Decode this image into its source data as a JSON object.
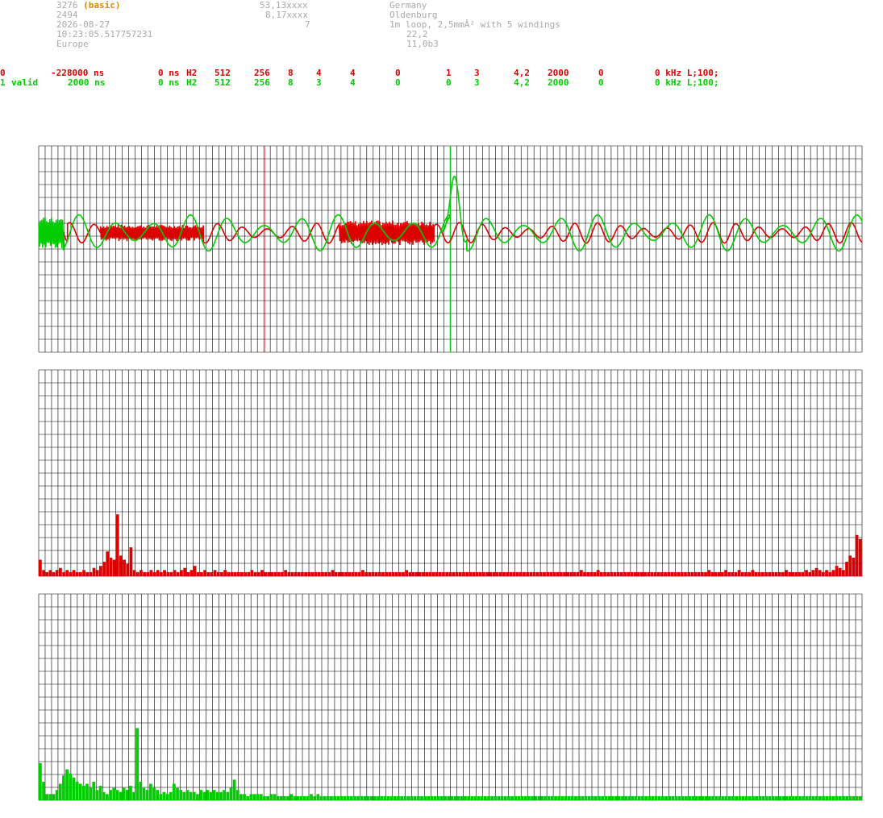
{
  "header": {
    "station_id": "3276",
    "station_type": "(basic)",
    "station_num": "2494",
    "date": "2026-08-27",
    "time": "10:23:05.517757231",
    "region": "Europe",
    "lat": "53,13xxxx",
    "lon": "8,17xxxx",
    "alt": "7",
    "country": "Germany",
    "city": "Oldenburg",
    "antenna": "1m loop, 2,5mmÂ² with 5 windings",
    "temp": "22,2",
    "version": "11,0b3"
  },
  "channels": [
    {
      "idx": "0",
      "status": "",
      "offset": "-228000 ns",
      "delay": "0 ns",
      "filter": "H2",
      "c1": "512",
      "c2": "256",
      "c3": "8",
      "c4": "4",
      "c5": "4",
      "c6": "0",
      "c7": "1",
      "c8": "3",
      "c9": "4,2",
      "c10": "2000",
      "c11": "0",
      "freq": "0 kHz L;100;"
    },
    {
      "idx": "1",
      "status": "valid",
      "offset": "2000 ns",
      "delay": "0 ns",
      "filter": "H2",
      "c1": "512",
      "c2": "256",
      "c3": "8",
      "c4": "3",
      "c5": "4",
      "c6": "0",
      "c7": "0",
      "c8": "3",
      "c9": "4,2",
      "c10": "2000",
      "c11": "0",
      "freq": "0 kHz L;100;"
    }
  ],
  "colors": {
    "channel0": "#dd0000",
    "channel1": "#00cc00",
    "grid": "#000000",
    "gray_text": "#a8a8a8",
    "type_label": "#d98a00"
  },
  "chart_data": [
    {
      "type": "line",
      "title": "",
      "ylim": [
        -1,
        1
      ],
      "grid": true,
      "trigger_marker_red_x": 0.275,
      "trigger_marker_green_x": 0.5,
      "series": [
        {
          "channel": 0,
          "color": "#dd0000",
          "segments": [
            {
              "x": [
                0.0,
                0.035
              ],
              "style": "wave",
              "amp": 0.08,
              "period": 0.02
            },
            {
              "x": [
                0.035,
                0.075
              ],
              "style": "wave",
              "amp": 0.1,
              "period": 0.03
            },
            {
              "x": [
                0.075,
                0.2
              ],
              "style": "dense",
              "amp": 0.08
            },
            {
              "x": [
                0.2,
                0.365
              ],
              "style": "wave",
              "amp": 0.1,
              "period": 0.03
            },
            {
              "x": [
                0.365,
                0.48
              ],
              "style": "dense",
              "amp": 0.12
            },
            {
              "x": [
                0.48,
                1.0
              ],
              "style": "wave",
              "amp": 0.1,
              "period": 0.028
            }
          ]
        },
        {
          "channel": 1,
          "color": "#00cc00",
          "segments": [
            {
              "x": [
                0.0,
                0.03
              ],
              "style": "dense",
              "amp": 0.15
            },
            {
              "x": [
                0.03,
                0.5
              ],
              "style": "wave",
              "amp": 0.18,
              "period": 0.045
            },
            {
              "x": [
                0.49,
                0.52
              ],
              "style": "spike",
              "peak": 0.55
            },
            {
              "x": [
                0.52,
                1.0
              ],
              "style": "wave",
              "amp": 0.18,
              "period": 0.045
            }
          ]
        }
      ]
    },
    {
      "type": "bar",
      "title": "",
      "channel": 0,
      "color": "#dd0000",
      "ylim": [
        0,
        100
      ],
      "values": [
        8,
        3,
        2,
        3,
        2,
        3,
        4,
        2,
        3,
        2,
        3,
        2,
        2,
        3,
        2,
        2,
        4,
        3,
        5,
        7,
        12,
        9,
        8,
        30,
        10,
        8,
        6,
        14,
        3,
        2,
        3,
        2,
        2,
        3,
        2,
        3,
        2,
        3,
        2,
        2,
        3,
        2,
        3,
        4,
        2,
        3,
        5,
        2,
        2,
        3,
        2,
        2,
        3,
        2,
        2,
        3,
        2,
        2,
        2,
        2,
        2,
        2,
        2,
        3,
        2,
        2,
        3,
        2,
        2,
        2,
        2,
        2,
        2,
        3,
        2,
        2,
        2,
        2,
        2,
        2,
        2,
        2,
        2,
        2,
        2,
        2,
        2,
        3,
        2,
        2,
        2,
        2,
        2,
        2,
        2,
        2,
        3,
        2,
        2,
        2,
        2,
        2,
        2,
        2,
        2,
        2,
        2,
        2,
        2,
        3,
        2,
        2,
        2,
        2,
        2,
        2,
        2,
        2,
        2,
        2,
        2,
        2,
        2,
        2,
        2,
        2,
        2,
        2,
        2,
        2,
        2,
        2,
        2,
        2,
        2,
        2,
        2,
        2,
        2,
        2,
        2,
        2,
        2,
        2,
        2,
        2,
        2,
        2,
        2,
        2,
        2,
        2,
        2,
        2,
        2,
        2,
        2,
        2,
        2,
        2,
        2,
        3,
        2,
        2,
        2,
        2,
        3,
        2,
        2,
        2,
        2,
        2,
        2,
        2,
        2,
        2,
        2,
        2,
        2,
        2,
        2,
        2,
        2,
        2,
        2,
        2,
        2,
        2,
        2,
        2,
        2,
        2,
        2,
        2,
        2,
        2,
        2,
        2,
        2,
        3,
        2,
        2,
        2,
        2,
        3,
        2,
        2,
        2,
        3,
        2,
        2,
        2,
        3,
        2,
        2,
        2,
        2,
        2,
        2,
        2,
        2,
        2,
        3,
        2,
        2,
        2,
        2,
        2,
        3,
        2,
        3,
        4,
        3,
        2,
        3,
        2,
        3,
        5,
        4,
        3,
        7,
        10,
        9,
        20,
        18
      ]
    },
    {
      "type": "bar",
      "title": "",
      "channel": 1,
      "color": "#00cc00",
      "ylim": [
        0,
        100
      ],
      "values": [
        18,
        9,
        3,
        3,
        3,
        5,
        8,
        12,
        15,
        13,
        11,
        9,
        8,
        7,
        8,
        6,
        9,
        5,
        7,
        4,
        3,
        5,
        6,
        5,
        4,
        6,
        5,
        7,
        4,
        35,
        9,
        6,
        5,
        8,
        6,
        5,
        3,
        4,
        3,
        4,
        8,
        6,
        5,
        4,
        5,
        4,
        4,
        3,
        5,
        4,
        5,
        4,
        5,
        4,
        4,
        5,
        4,
        6,
        10,
        5,
        3,
        3,
        2,
        3,
        3,
        3,
        3,
        2,
        2,
        3,
        3,
        2,
        2,
        2,
        2,
        3,
        2,
        2,
        2,
        2,
        2,
        3,
        2,
        3,
        2,
        2,
        2,
        2,
        2,
        2,
        2,
        2,
        2,
        2,
        2,
        2,
        2,
        2,
        2,
        2,
        2,
        2,
        2,
        2,
        2,
        2,
        2,
        2,
        2,
        2,
        2,
        2,
        2,
        2,
        2,
        2,
        2,
        2,
        2,
        2,
        2,
        2,
        2,
        2,
        2,
        2,
        2,
        2,
        2,
        2,
        2,
        2,
        2,
        2,
        2,
        2,
        2,
        2,
        2,
        2,
        2,
        2,
        2,
        2,
        2,
        2,
        2,
        2,
        2,
        2,
        2,
        2,
        2,
        2,
        2,
        2,
        2,
        2,
        2,
        2,
        2,
        2,
        2,
        2,
        2,
        2,
        2,
        2,
        2,
        2,
        2,
        2,
        2,
        2,
        2,
        2,
        2,
        2,
        2,
        2,
        2,
        2,
        2,
        2,
        2,
        2,
        2,
        2,
        2,
        2,
        2,
        2,
        2,
        2,
        2,
        2,
        2,
        2,
        2,
        2,
        2,
        2,
        2,
        2,
        2,
        2,
        2,
        2,
        2,
        2,
        2,
        2,
        2,
        2,
        2,
        2,
        2,
        2,
        2,
        2,
        2,
        2,
        2,
        2,
        2,
        2,
        2,
        2,
        2,
        2,
        2,
        2,
        2,
        2,
        2,
        2,
        2,
        2,
        2,
        2,
        2,
        2,
        2,
        2,
        2,
        2
      ]
    }
  ]
}
